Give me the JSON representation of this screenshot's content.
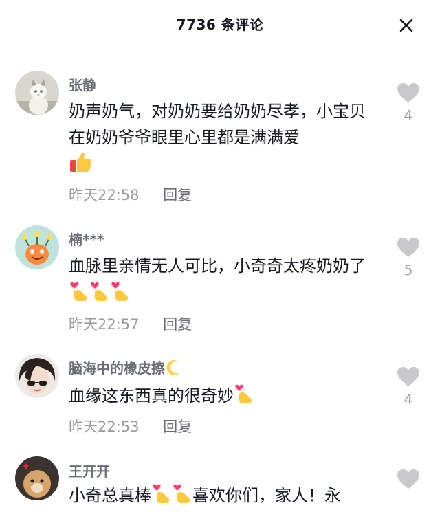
{
  "header": {
    "title": "7736 条评论"
  },
  "comments": [
    {
      "username": "张静",
      "text": "奶声奶气，对奶奶要给奶奶尽孝，小宝贝在奶奶爷爷眼里心里都是满满爱",
      "emojis": [
        "thumbs-up"
      ],
      "time": "昨天22:58",
      "reply": "回复",
      "likes": "4"
    },
    {
      "username": "楠***",
      "text": "血脉里亲情无人可比，小奇奇太疼奶奶了",
      "emojis": [
        "finger-heart",
        "finger-heart",
        "finger-heart"
      ],
      "time": "昨天22:57",
      "reply": "回复",
      "likes": "5"
    },
    {
      "username": "脑海中的橡皮擦",
      "text": "血缘这东西真的很奇妙",
      "emojis": [
        "finger-heart"
      ],
      "time": "昨天22:53",
      "reply": "回复",
      "likes": "4"
    },
    {
      "username": "王开开",
      "text": "小奇总真棒",
      "text_tail": "喜欢你们，家人！永",
      "emojis": [
        "finger-heart",
        "finger-heart"
      ],
      "likes": ""
    }
  ]
}
